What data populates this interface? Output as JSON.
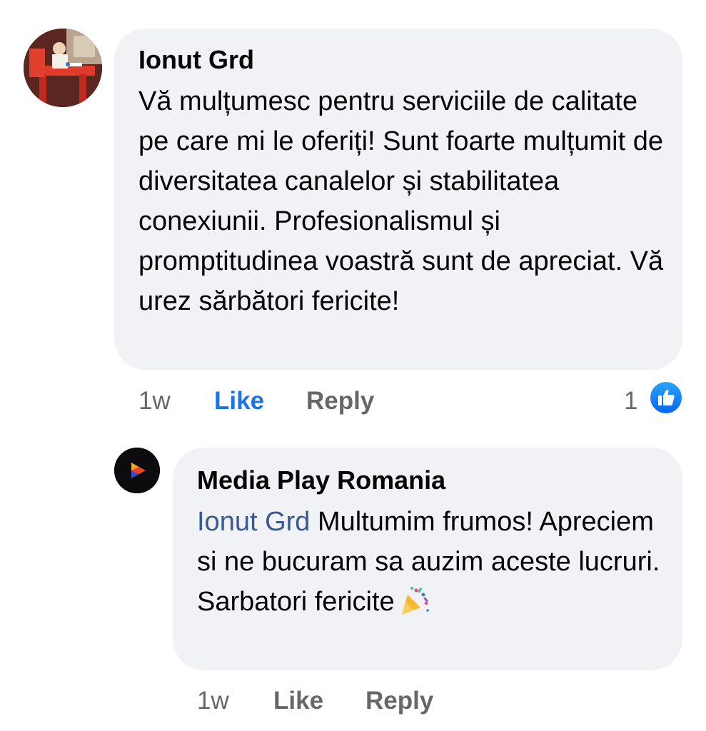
{
  "comment": {
    "author": "Ionut Grd",
    "text": "Vă mulțumesc pentru serviciile de calitate pe care mi le oferiți! Sunt foarte mulțumit de diversitatea canalelor și stabilitatea conexiunii. Profesionalismul și promptitudinea voastră sunt de apreciat. Vă urez sărbători fericite!",
    "time": "1w",
    "like_label": "Like",
    "reply_label": "Reply",
    "reaction_count": "1",
    "reaction_icon": "thumbs-up-icon",
    "liked": true
  },
  "reply": {
    "author": "Media Play Romania",
    "mention": "Ionut Grd",
    "text": " Multumim frumos! Apreciem si ne bucuram sa auzim aceste lucruri. Sarbatori fericite",
    "emoji": "party-popper-icon",
    "time": "1w",
    "like_label": "Like",
    "reply_label": "Reply"
  },
  "colors": {
    "bubble": "#f0f2f5",
    "liked_blue": "#1b74e4",
    "mention_blue": "#385898",
    "secondary_text": "#65676b"
  }
}
